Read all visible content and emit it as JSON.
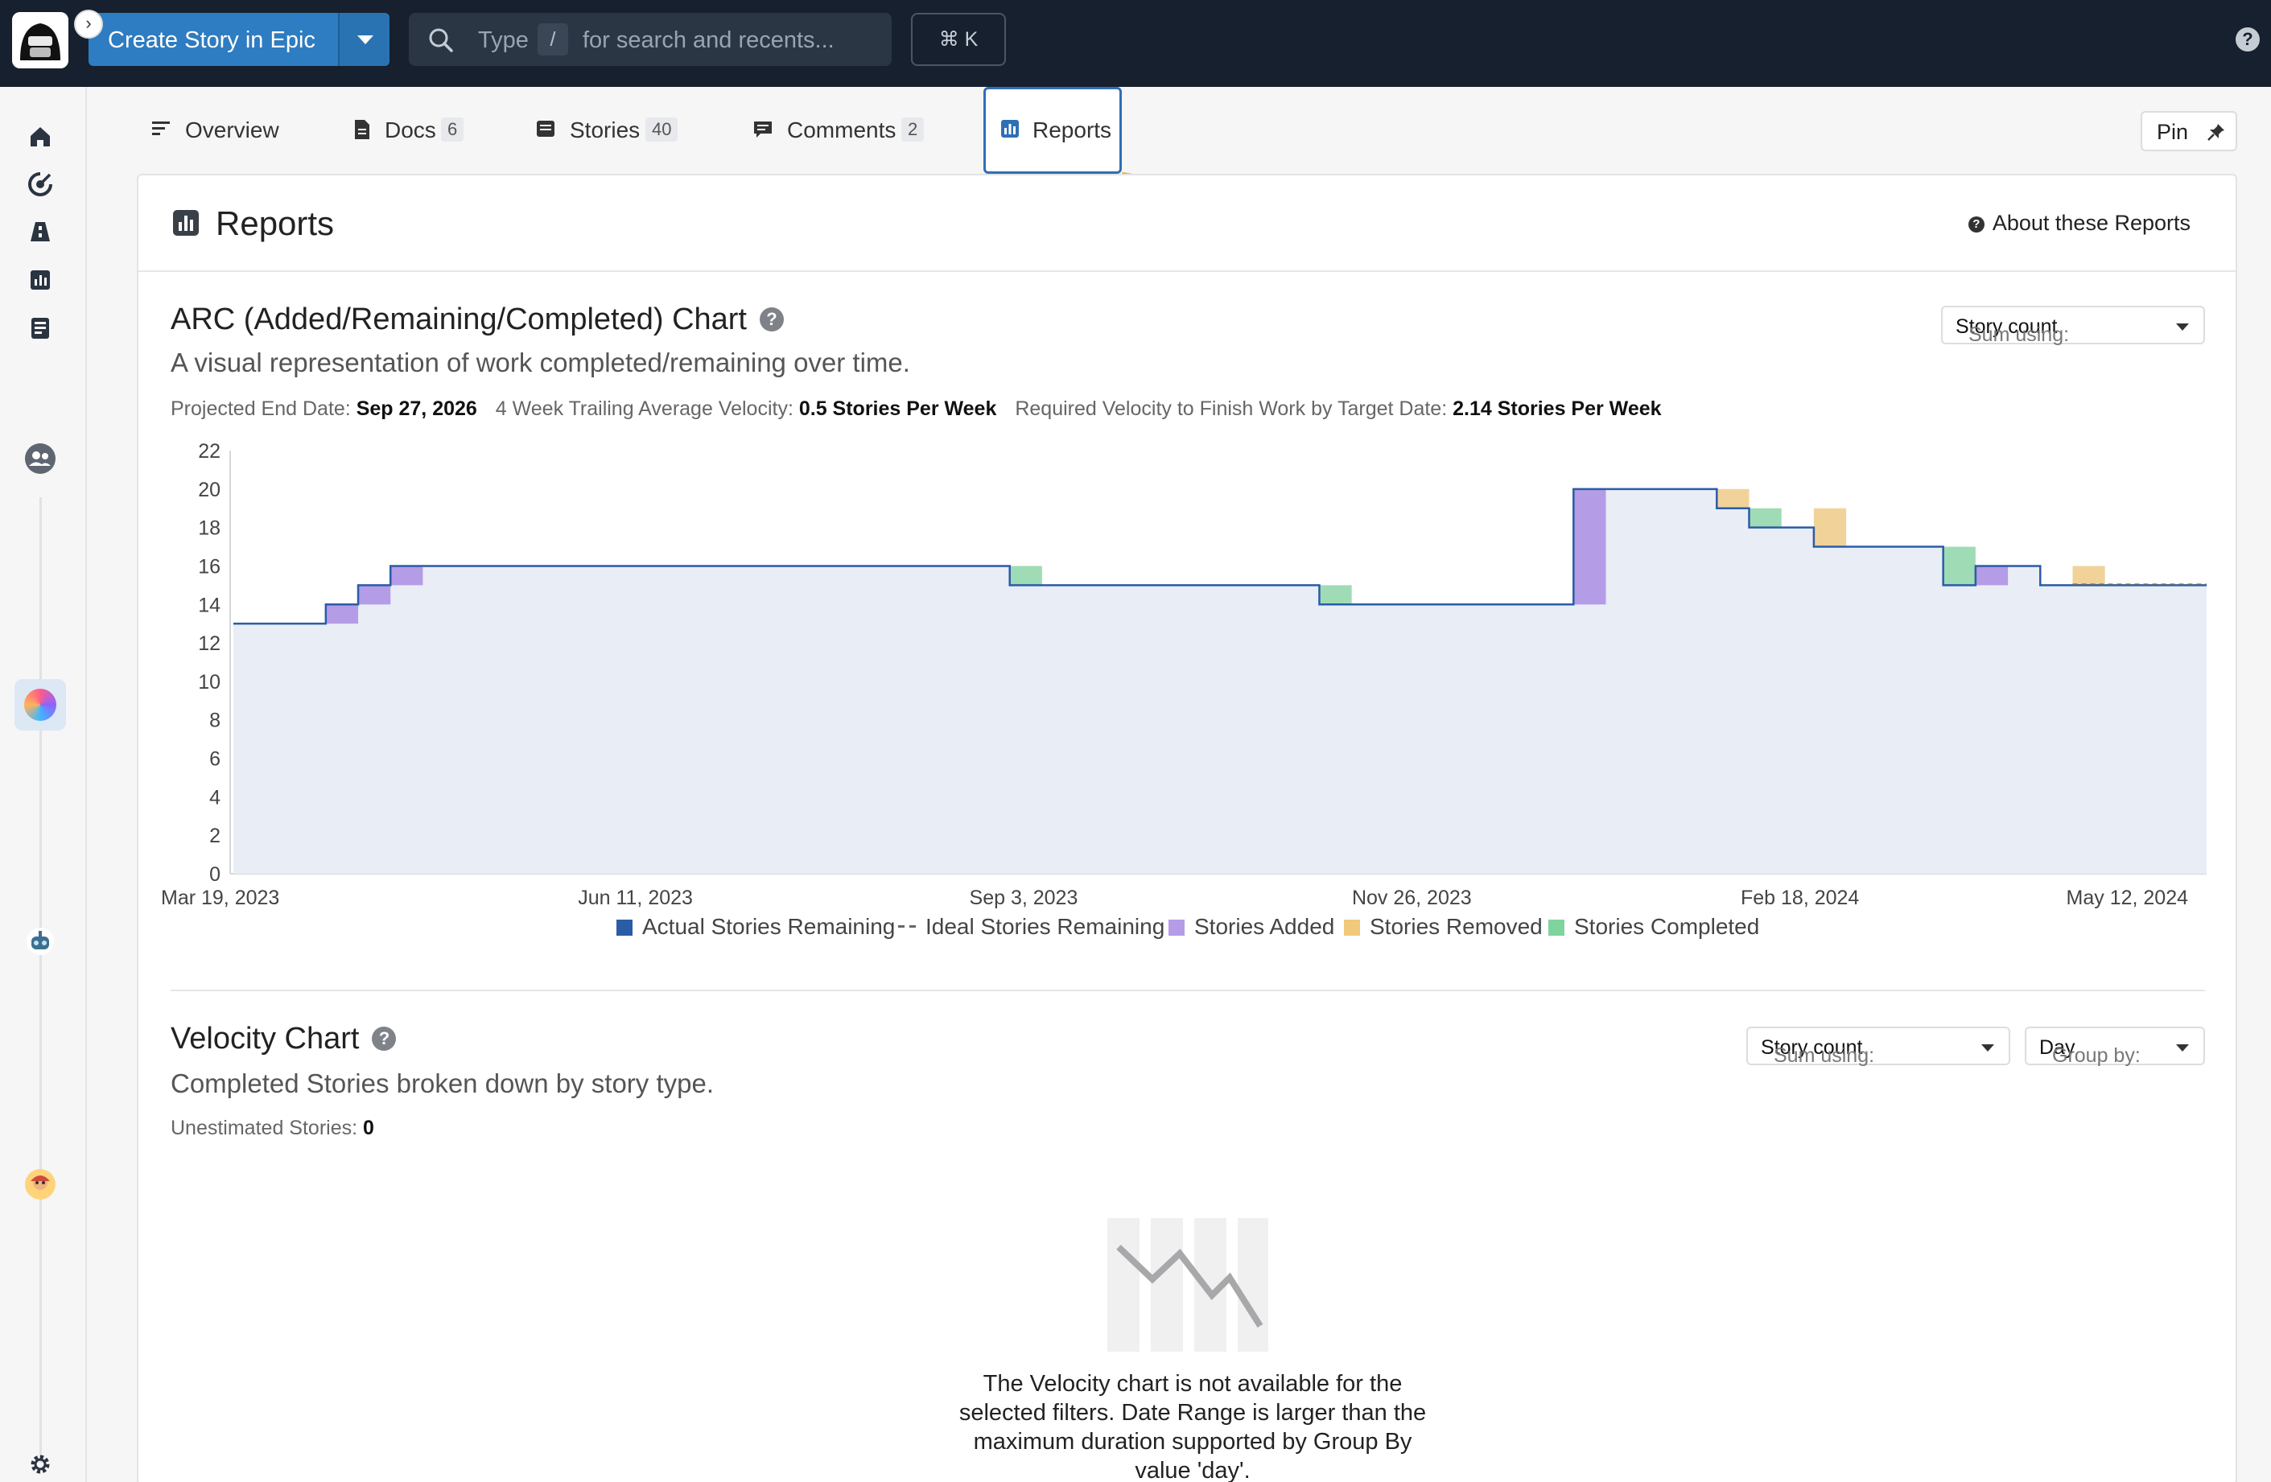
{
  "topbar": {
    "create_label": "Create Story in Epic",
    "search_placeholder_pre": "Type",
    "search_key": "/",
    "search_placeholder_post": "for search and recents...",
    "shortcut": "⌘ K",
    "help": "?"
  },
  "tabs": [
    {
      "label": "Overview",
      "icon": "list-icon"
    },
    {
      "label": "Docs",
      "count": "6",
      "icon": "doc-icon"
    },
    {
      "label": "Stories",
      "count": "40",
      "icon": "story-icon"
    },
    {
      "label": "Comments",
      "count": "2",
      "icon": "comment-icon"
    },
    {
      "label": "Reports",
      "icon": "report-icon",
      "active": true
    }
  ],
  "pin_label": "Pin",
  "reports": {
    "title": "Reports",
    "about": "About these Reports"
  },
  "arc": {
    "title": "ARC (Added/Remaining/Completed) Chart",
    "description": "A visual representation of work completed/remaining over time.",
    "sum_label": "Sum using:",
    "sum_value": "Story count",
    "projected_label": "Projected End Date:",
    "projected_value": "Sep 27, 2026",
    "velocity_label": "4 Week Trailing Average Velocity:",
    "velocity_value": "0.5 Stories Per Week",
    "required_label": "Required Velocity to Finish Work by Target Date:",
    "required_value": "2.14 Stories Per Week"
  },
  "velocity": {
    "title": "Velocity Chart",
    "description": "Completed Stories broken down by story type.",
    "sum_label": "Sum using:",
    "sum_value": "Story count",
    "group_label": "Group by:",
    "group_value": "Day",
    "unestimated_label": "Unestimated Stories:",
    "unestimated_value": "0",
    "empty_message": "The Velocity chart is not available for the selected filters. Date Range is larger than the maximum duration supported by Group By value 'day'."
  },
  "colors": {
    "actual": "#2a5ca8",
    "ideal": "#666666",
    "added": "#b49ce6",
    "removed": "#f1d39a",
    "completed": "#9fdcb5",
    "area": "#e9edf6",
    "accent": "#2e7cc1"
  },
  "chart_data": {
    "type": "area",
    "title": "ARC (Added/Remaining/Completed) Chart",
    "ylim": [
      0,
      22
    ],
    "y_ticks": [
      "0",
      "2",
      "4",
      "6",
      "8",
      "10",
      "12",
      "14",
      "16",
      "18",
      "20",
      "22"
    ],
    "x_ticks": [
      {
        "label": "Mar 19, 2023",
        "date": "2023-03-19"
      },
      {
        "label": "Jun 11, 2023",
        "date": "2023-06-11"
      },
      {
        "label": "Sep 3, 2023",
        "date": "2023-09-03"
      },
      {
        "label": "Nov 26, 2023",
        "date": "2023-11-26"
      },
      {
        "label": "Feb 18, 2024",
        "date": "2024-02-18"
      },
      {
        "label": "May 12, 2024",
        "date": "2024-05-12"
      }
    ],
    "x_range": [
      "2023-03-16",
      "2024-05-16"
    ],
    "series": [
      {
        "name": "Actual Stories Remaining",
        "style": "step",
        "points": [
          [
            "2023-03-16",
            13
          ],
          [
            "2023-04-05",
            14
          ],
          [
            "2023-04-12",
            15
          ],
          [
            "2023-04-19",
            16
          ],
          [
            "2023-08-31",
            15
          ],
          [
            "2023-11-06",
            14
          ],
          [
            "2023-12-31",
            20
          ],
          [
            "2024-01-31",
            19
          ],
          [
            "2024-02-07",
            18
          ],
          [
            "2024-02-21",
            17
          ],
          [
            "2024-03-20",
            15
          ],
          [
            "2024-03-27",
            16
          ],
          [
            "2024-04-10",
            15
          ],
          [
            "2024-05-16",
            15
          ]
        ]
      },
      {
        "name": "Ideal Stories Remaining",
        "style": "dashed",
        "points": [
          [
            "2024-04-17",
            15
          ],
          [
            "2024-05-16",
            15
          ]
        ]
      },
      {
        "name": "Stories Added",
        "type": "bar",
        "bars": [
          [
            "2023-04-05",
            13,
            14
          ],
          [
            "2023-04-12",
            14,
            15
          ],
          [
            "2023-04-19",
            15,
            16
          ],
          [
            "2023-12-31",
            14,
            20
          ],
          [
            "2024-03-27",
            15,
            16
          ]
        ]
      },
      {
        "name": "Stories Removed",
        "type": "bar",
        "bars": [
          [
            "2024-01-31",
            19,
            20
          ],
          [
            "2024-02-21",
            17,
            19
          ],
          [
            "2024-04-17",
            15,
            16
          ]
        ]
      },
      {
        "name": "Stories Completed",
        "type": "bar",
        "bars": [
          [
            "2023-08-31",
            15,
            16
          ],
          [
            "2023-11-06",
            14,
            15
          ],
          [
            "2024-02-07",
            18,
            19
          ],
          [
            "2024-03-20",
            15,
            17
          ]
        ]
      }
    ]
  }
}
